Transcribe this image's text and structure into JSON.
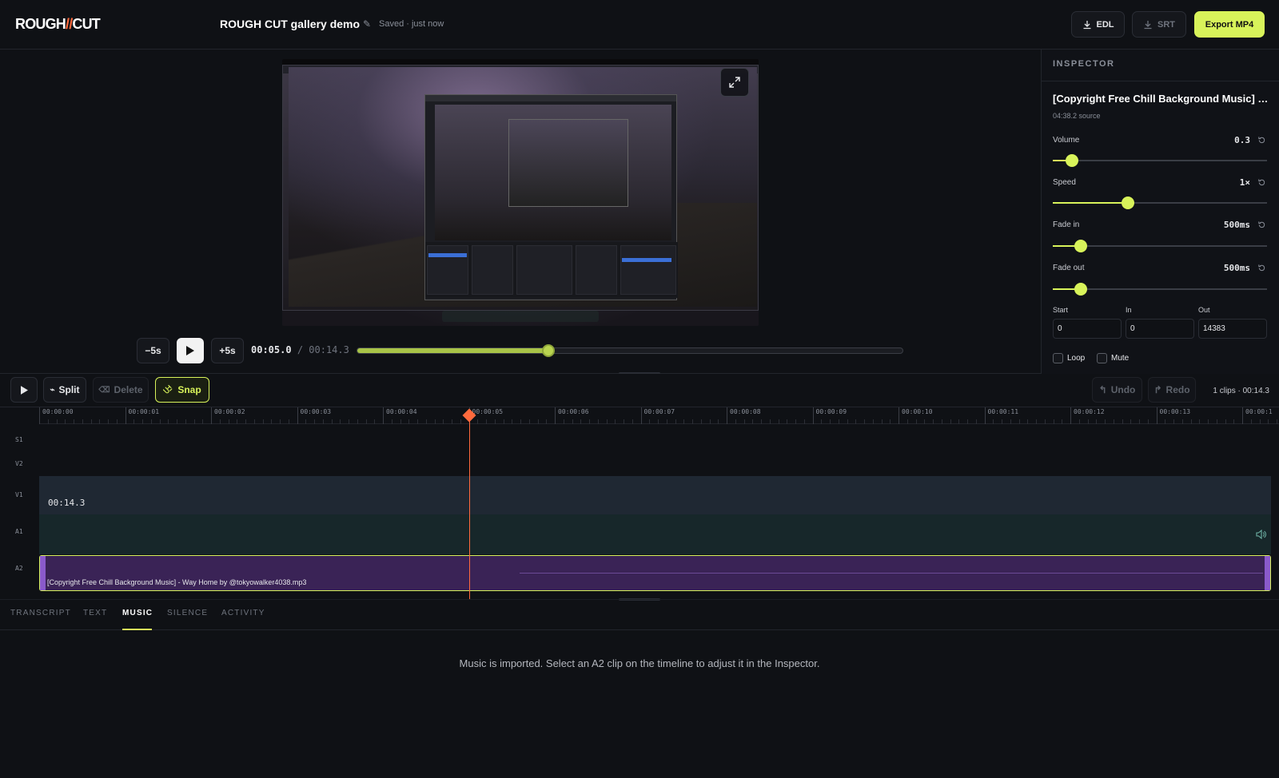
{
  "header": {
    "logo_left": "ROUGH",
    "logo_slash": "//",
    "logo_right": "CUT",
    "project_title": "ROUGH CUT gallery demo",
    "edit_icon": "pencil-icon",
    "save_status": "Saved · just now",
    "buttons": {
      "edl": "EDL",
      "srt": "SRT",
      "export": "Export MP4"
    }
  },
  "preview": {
    "skip_back": "−5s",
    "skip_forward": "+5s",
    "current_time": "00:05.0",
    "separator": "/",
    "total_time": "00:14.3",
    "progress_fraction": 0.35
  },
  "inspector": {
    "heading": "INSPECTOR",
    "clip_title": "[Copyright Free Chill Background Music] - Way Home by @tokyowalker4038.mp3",
    "clip_source": "04:38.2 source",
    "controls": [
      {
        "label": "Volume",
        "value": "0.3",
        "fraction": 0.09
      },
      {
        "label": "Speed",
        "value": "1×",
        "fraction": 0.35
      },
      {
        "label": "Fade in",
        "value": "500ms",
        "fraction": 0.13
      },
      {
        "label": "Fade out",
        "value": "500ms",
        "fraction": 0.13
      }
    ],
    "fields": [
      {
        "label": "Start",
        "value": "0"
      },
      {
        "label": "In",
        "value": "0"
      },
      {
        "label": "Out",
        "value": "14383"
      }
    ],
    "loop_label": "Loop",
    "mute_label": "Mute"
  },
  "timeline_toolbar": {
    "split": "Split",
    "delete": "Delete",
    "snap": "Snap",
    "undo": "Undo",
    "redo": "Redo",
    "clip_count": "1 clips · 00:14.3"
  },
  "timeline": {
    "ticks": [
      "00:00:00",
      "00:00:01",
      "00:00:02",
      "00:00:03",
      "00:00:04",
      "00:00:05",
      "00:00:06",
      "00:00:07",
      "00:00:08",
      "00:00:09",
      "00:00:10",
      "00:00:11",
      "00:00:12",
      "00:00:13",
      "00:00:1"
    ],
    "tracks": {
      "s1": "S1",
      "v2": "V2",
      "v1": "V1",
      "a1": "A1",
      "a2": "A2"
    },
    "v1_duration": "00:14.3",
    "a2_clip_label": "[Copyright Free Chill Background Music] - Way Home by @tokyowalker4038.mp3",
    "playhead_seconds": 5.0
  },
  "tabs": [
    "TRANSCRIPT",
    "TEXT",
    "MUSIC",
    "SILENCE",
    "ACTIVITY"
  ],
  "active_tab": "MUSIC",
  "music_message": "Music is imported. Select an A2 clip on the timeline to adjust it in the Inspector.",
  "colors": {
    "accent": "#d8f35a",
    "playhead": "#ff6a3d",
    "a2_clip": "#3a2356"
  }
}
